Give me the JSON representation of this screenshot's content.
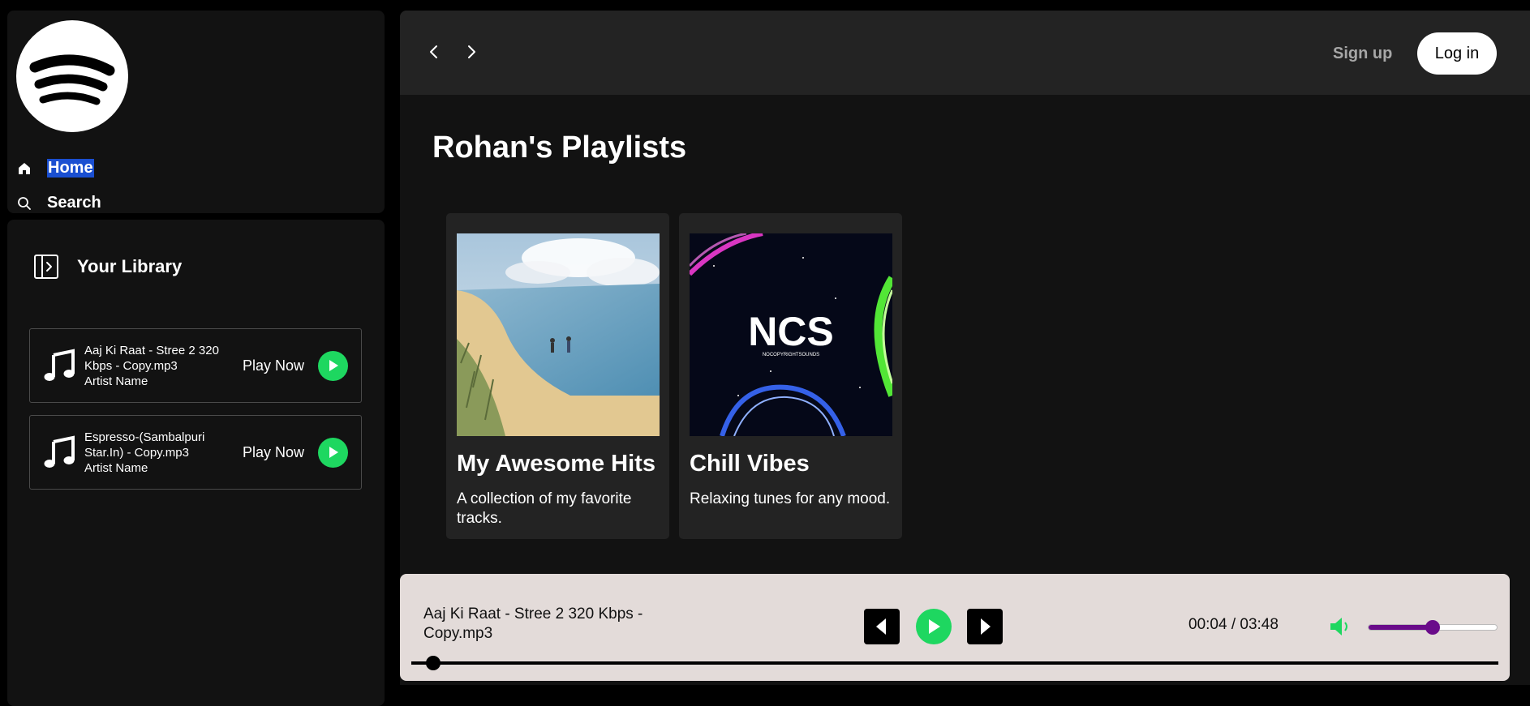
{
  "sidebar": {
    "logo_icon": "spotify-logo",
    "nav": [
      {
        "label": "Home",
        "icon": "home-icon"
      },
      {
        "label": "Search",
        "icon": "search-icon"
      }
    ],
    "library": {
      "title": "Your Library",
      "icon": "library-icon",
      "songs": [
        {
          "title": "Aaj Ki Raat - Stree 2 320 Kbps - Copy.mp3",
          "artist": "Artist Name",
          "action": "Play Now"
        },
        {
          "title": "Espresso-(Sambalpuri Star.In) - Copy.mp3",
          "artist": "Artist Name",
          "action": "Play Now"
        }
      ]
    }
  },
  "header": {
    "signup_label": "Sign up",
    "login_label": "Log in"
  },
  "main": {
    "title": "Rohan's Playlists",
    "cards": [
      {
        "title": "My Awesome Hits",
        "description": "A collection of my favorite tracks."
      },
      {
        "title": "Chill Vibes",
        "description": "Relaxing tunes for any mood.",
        "cover_text": "NCS",
        "cover_subtext": "NOCOPYRIGHTSOUNDS"
      }
    ]
  },
  "player": {
    "song_title": "Aaj Ki Raat - Stree 2 320 Kbps - Copy.mp3",
    "time": "00:04 / 03:48",
    "volume_percent": 50,
    "progress_percent": 2
  },
  "colors": {
    "accent_green": "#1ed760",
    "volume_purple": "#6a0b8a",
    "player_bg": "#e3dbd9",
    "panel_bg": "#121212",
    "topbar_bg": "#232323"
  }
}
